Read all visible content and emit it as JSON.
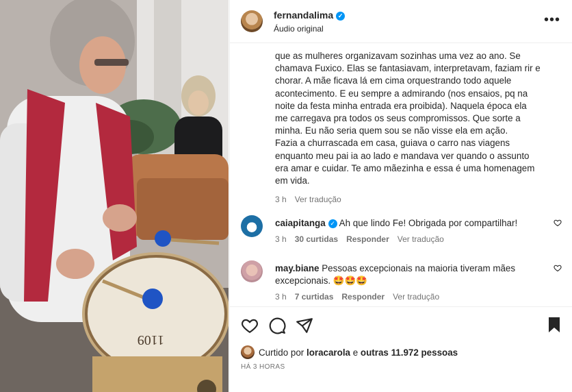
{
  "post": {
    "username": "fernandalima",
    "audio": "Áudio original",
    "more_icon": "more-horizontal-icon"
  },
  "caption": {
    "lines": [
      "que as mulheres organizavam sozinhas uma vez ao ano. Se",
      "chamava Fuxico. Elas se fantasiavam, interpretavam, faziam rir e",
      "chorar. A mãe ficava lá em cima orquestrando todo aquele",
      "acontecimento. E eu sempre a admirando (nos ensaios, pq na",
      "noite da festa minha entrada era proibida). Naquela época ela",
      "me carregava pra todos os seus compromissos. Que sorte a",
      "minha. Eu não seria quem sou se não visse ela em ação.",
      "Fazia a churrascada em casa, guiava o carro nas viagens",
      "enquanto meu pai ia ao lado e mandava ver quando o assunto",
      "era amar e cuidar. Te amo mãezinha e essa é uma homenagem",
      "em vida."
    ],
    "time": "3 h",
    "translate": "Ver tradução"
  },
  "comments": [
    {
      "username": "caiapitanga",
      "verified": true,
      "text": "Ah que lindo Fe! Obrigada por compartilhar!",
      "time": "3 h",
      "likes": "30 curtidas",
      "reply": "Responder",
      "translate": "Ver tradução"
    },
    {
      "username": "may.biane",
      "verified": false,
      "text_line1": "Pessoas excepcionais na maioria tiveram mães",
      "text_line2": "excepcionais. 🤩🤩🤩",
      "time": "3 h",
      "likes": "7 curtidas",
      "reply": "Responder",
      "translate": "Ver tradução"
    }
  ],
  "likes": {
    "prefix": "Curtido por",
    "user": "loracarola",
    "connector": "e",
    "others": "outras 11.972 pessoas"
  },
  "posted_ago": "HÁ 3 HORAS",
  "media": {
    "drum_label": "1109"
  },
  "colors": {
    "verified": "#0095f6",
    "secondary_text": "#737373",
    "vest": "#b3293e"
  }
}
